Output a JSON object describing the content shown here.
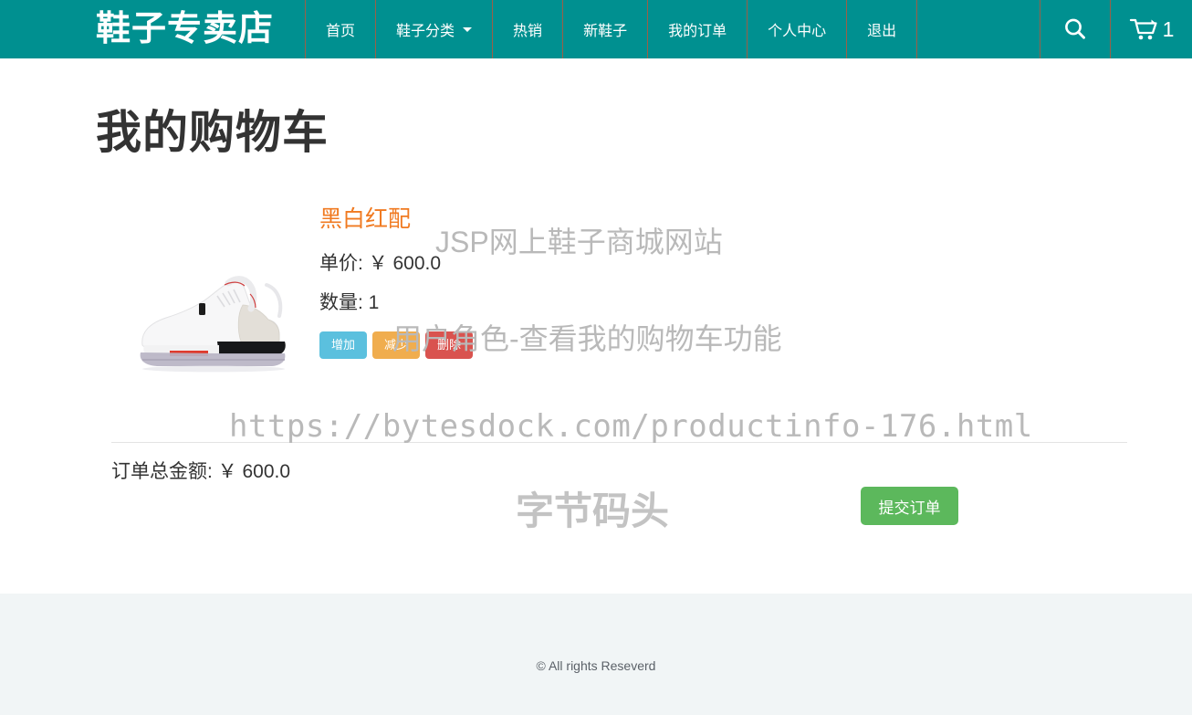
{
  "navbar": {
    "brand": "鞋子专卖店",
    "brand_color": "#ffffff",
    "background_color": "#009090",
    "separator_color": "#9b5f47",
    "links": [
      {
        "label": "首页",
        "has_caret": false
      },
      {
        "label": "鞋子分类",
        "has_caret": true
      },
      {
        "label": "热销",
        "has_caret": false
      },
      {
        "label": "新鞋子",
        "has_caret": false
      },
      {
        "label": "我的订单",
        "has_caret": false
      },
      {
        "label": "个人中心",
        "has_caret": false
      },
      {
        "label": "退出",
        "has_caret": false
      }
    ],
    "search_icon": "search-icon",
    "cart_icon": "shopping-cart-icon",
    "cart_count": "1"
  },
  "main": {
    "page_title": "我的购物车",
    "cart_items": [
      {
        "image_alt": "白色运动鞋",
        "title": "黑白红配",
        "title_color": "#f07a21",
        "price_label": "单价: ￥ 600.0",
        "quantity_label": "数量: 1",
        "buttons": {
          "increase": "增加",
          "decrease": "减少",
          "delete": "删除"
        },
        "button_colors": {
          "increase": "#5bc0de",
          "decrease": "#f0ad4e",
          "delete": "#d9534f"
        }
      }
    ],
    "total_label": "订单总金额: ￥ 600.0",
    "submit_label": "提交订单",
    "submit_color": "#5cb85c"
  },
  "watermarks": {
    "line1": "JSP网上鞋子商城网站",
    "line2": "用户角色-查看我的购物车功能",
    "url": "https://bytesdock.com/productinfo-176.html",
    "brand": "字节码头",
    "color": "#b9b9b9"
  },
  "footer": {
    "copyright": "© All rights Reseverd",
    "background_color": "#f1f5f6"
  }
}
